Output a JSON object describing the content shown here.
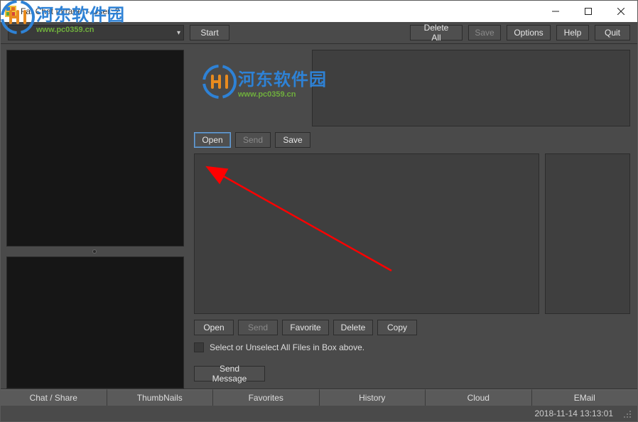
{
  "title": "Fat Chat Intranet - User: 2",
  "toolbar": {
    "start": "Start",
    "delete_all": "Delete All",
    "save": "Save",
    "options": "Options",
    "help": "Help",
    "quit": "Quit"
  },
  "image_buttons": {
    "open": "Open",
    "send": "Send",
    "save": "Save"
  },
  "file_buttons": {
    "open": "Open",
    "send": "Send",
    "favorite": "Favorite",
    "delete": "Delete",
    "copy": "Copy"
  },
  "checkbox_label": "Select or Unselect All Files in Box above.",
  "send_message": "Send Message",
  "tabs": {
    "chat_share": "Chat / Share",
    "thumbnails": "ThumbNails",
    "favorites": "Favorites",
    "history": "History",
    "cloud": "Cloud",
    "email": "EMail"
  },
  "status_time": "2018-11-14 13:13:01",
  "watermark": {
    "text": "河东软件园",
    "url": "www.pc0359.cn"
  }
}
